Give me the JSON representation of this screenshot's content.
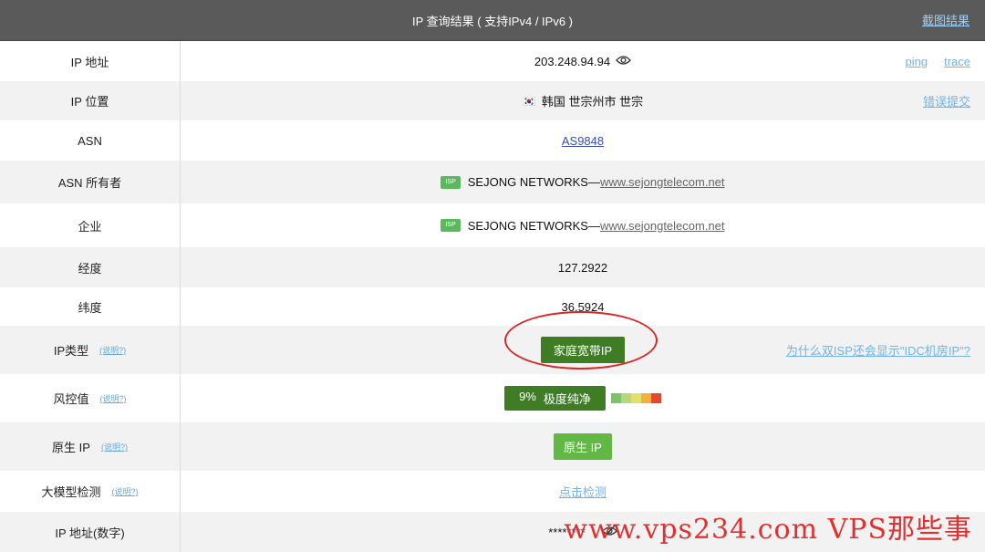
{
  "header": {
    "title": "IP 查询结果 ( 支持IPv4 / IPv6 )",
    "snapshot_link": "截图结果"
  },
  "rows": {
    "ip": {
      "label": "IP 地址",
      "value": "203.248.94.94",
      "ping": "ping",
      "trace": "trace"
    },
    "location": {
      "label": "IP 位置",
      "flag": "🇰🇷",
      "value": "韩国 世宗州市 世宗",
      "report": "错误提交"
    },
    "asn": {
      "label": "ASN",
      "value": "AS9848"
    },
    "asn_owner": {
      "label": "ASN 所有者",
      "badge": "ISP",
      "name": "SEJONG NETWORKS—",
      "site": "www.sejongtelecom.net"
    },
    "company": {
      "label": "企业",
      "badge": "ISP",
      "name": "SEJONG NETWORKS—",
      "site": "www.sejongtelecom.net"
    },
    "longitude": {
      "label": "经度",
      "value": "127.2922"
    },
    "latitude": {
      "label": "纬度",
      "value": "36.5924"
    },
    "ip_type": {
      "label": "IP类型",
      "explain": "(说明?)",
      "value": "家庭宽带IP",
      "why": "为什么双ISP还会显示\"IDC机房IP\"?"
    },
    "risk": {
      "label": "风控值",
      "explain": "(说明?)",
      "percent": "9%",
      "level": "极度纯净",
      "scale_colors": [
        "#7cc26a",
        "#b6d77a",
        "#e3e070",
        "#f2b13a",
        "#e2492e"
      ]
    },
    "native": {
      "label": "原生 IP",
      "explain": "(说明?)",
      "value": "原生 IP"
    },
    "llm": {
      "label": "大模型检测",
      "explain": "(说明?)",
      "value": "点击检测"
    },
    "ip_numeric": {
      "label": "IP 地址(数字)",
      "value": "********"
    }
  },
  "watermark": "www.vps234.com  VPS那些事",
  "colors": {
    "header_bg": "#5a5a5a",
    "badge_green": "#5cb85c",
    "tag_dark_green": "#3f7d25",
    "tag_green": "#62b845",
    "circle_red": "#d62828"
  }
}
